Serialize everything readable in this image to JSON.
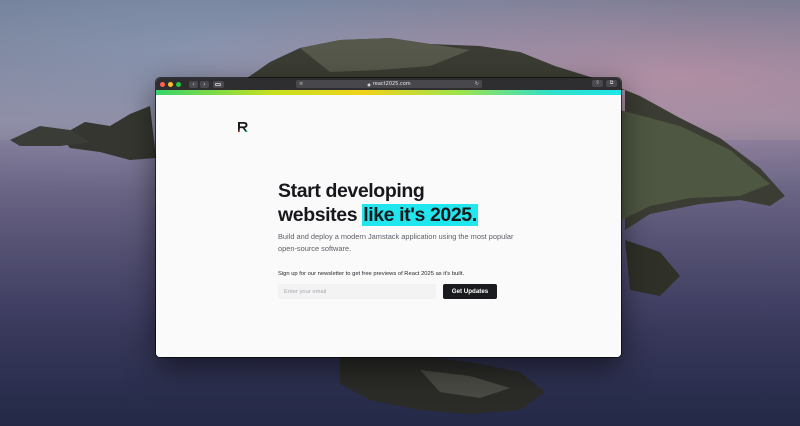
{
  "browser": {
    "url": "react2025.com",
    "nav_back_glyph": "‹",
    "nav_forward_glyph": "›",
    "reader_glyph": "≡",
    "reload_glyph": "↻",
    "share_glyph": "⇧",
    "tabs_glyph": "⧉",
    "lock_icon": "lock-icon"
  },
  "colors": {
    "highlight": "#22e6ee",
    "button_bg": "#1a1b1f",
    "page_bg": "#fafafa",
    "heading": "#17181c",
    "accent_gradient": [
      "#35d46a",
      "#c6e01f",
      "#f0d219",
      "#9ee24a",
      "#2fe0c8",
      "#1ee6ea"
    ]
  },
  "hero": {
    "title_line1": "Start developing",
    "title_line2_prefix": "websites ",
    "title_line2_highlight": "like it's 2025.",
    "subtitle": "Build and deploy a modern Jamstack application using the most popular open-source software."
  },
  "newsletter": {
    "label": "Sign up for our newsletter to get free previews of React 2025 as it's built.",
    "email_placeholder": "Enter your email",
    "email_value": "",
    "button_label": "Get Updates"
  }
}
